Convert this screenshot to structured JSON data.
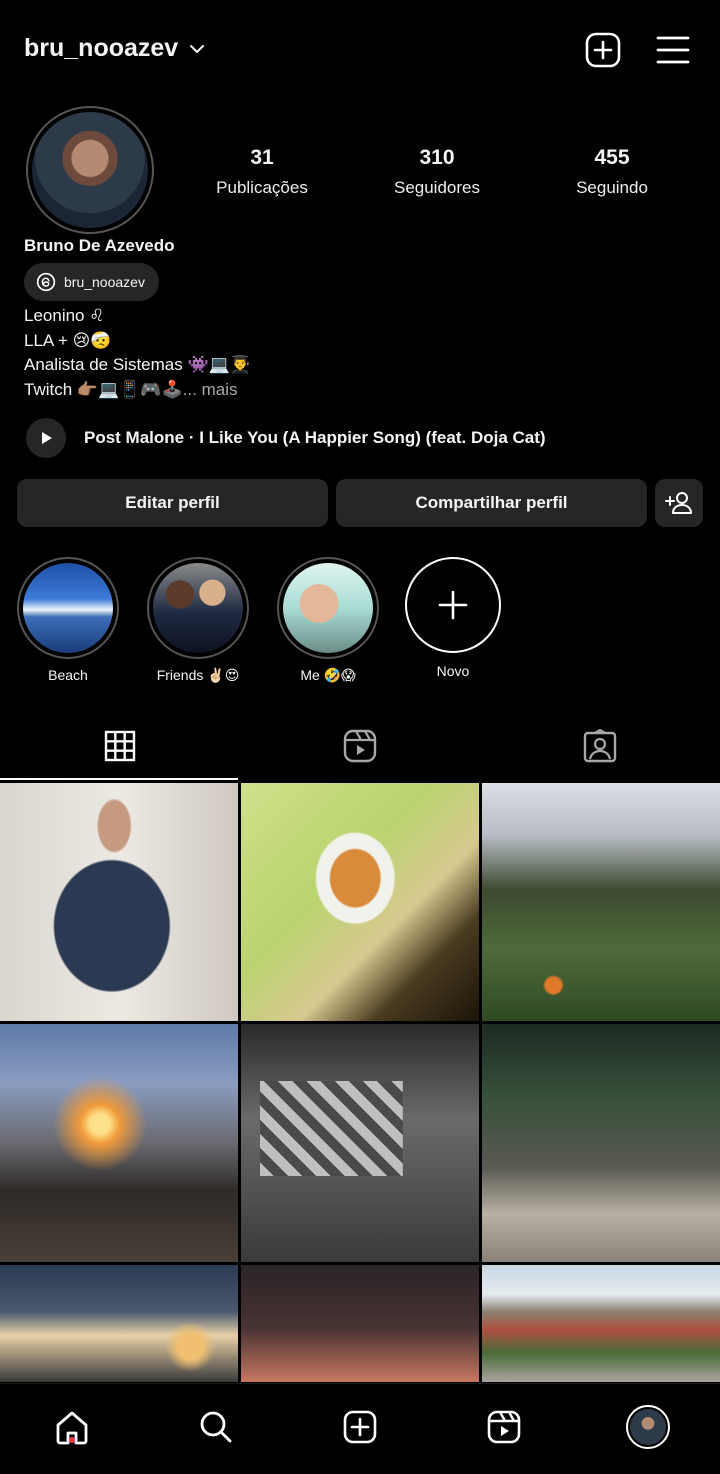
{
  "header": {
    "username": "bru_nooazev"
  },
  "profile": {
    "full_name": "Bruno De Azevedo",
    "threads_handle": "bru_nooazev",
    "stats": [
      {
        "value": "31",
        "label": "Publicações"
      },
      {
        "value": "310",
        "label": "Seguidores"
      },
      {
        "value": "455",
        "label": "Seguindo"
      }
    ],
    "bio": [
      "Leonino ♌",
      "LLA + 😢🤕",
      "Analista de Sistemas 👾💻👨‍🎓",
      "Twitch 👉🏽💻📱🎮🕹️"
    ],
    "bio_more": "... mais"
  },
  "music": {
    "track": "Post Malone · I Like You (A Happier Song) (feat. Doja Cat)"
  },
  "buttons": {
    "edit": "Editar perfil",
    "share": "Compartilhar perfil"
  },
  "highlights": [
    {
      "label": "Beach"
    },
    {
      "label": "Friends ✌🏻😍"
    },
    {
      "label": "Me 🤣😱"
    },
    {
      "label": "Novo"
    }
  ],
  "icons": {
    "header": [
      "chevron-down-icon",
      "add-post-icon",
      "menu-icon"
    ],
    "threads": "threads-icon",
    "music": "play-icon",
    "discover": "add-person-icon",
    "tabs": [
      "grid-icon",
      "reels-icon",
      "tagged-icon"
    ],
    "nav": [
      "home-icon",
      "search-icon",
      "create-icon",
      "reels-icon",
      "profile-avatar"
    ]
  },
  "colors": {
    "background": "#000000",
    "button": "#262626",
    "notification_dot": "#ff3040",
    "muted_text": "#a8a8a8"
  }
}
